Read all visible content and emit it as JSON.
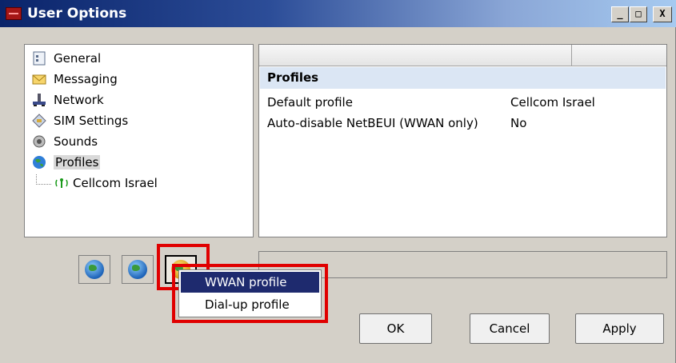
{
  "window": {
    "title": "User Options",
    "controls": {
      "minimize": "_",
      "maximize": "□",
      "close": "X"
    }
  },
  "tree": {
    "items": [
      {
        "label": "General",
        "icon": "general-icon"
      },
      {
        "label": "Messaging",
        "icon": "envelope-icon"
      },
      {
        "label": "Network",
        "icon": "network-icon"
      },
      {
        "label": "SIM Settings",
        "icon": "sim-card-icon"
      },
      {
        "label": "Sounds",
        "icon": "speaker-icon"
      },
      {
        "label": "Profiles",
        "icon": "globe-icon",
        "selected": true
      },
      {
        "label": "Cellcom Israel",
        "icon": "antenna-icon"
      }
    ]
  },
  "properties": {
    "section": "Profiles",
    "rows": [
      {
        "name": "Default profile",
        "value": "Cellcom Israel"
      },
      {
        "name": "Auto-disable NetBEUI (WWAN only)",
        "value": "No"
      }
    ]
  },
  "toolbar": {
    "buttons": [
      {
        "icon": "add-profile-icon"
      },
      {
        "icon": "edit-profile-icon"
      },
      {
        "icon": "new-profile-icon"
      }
    ]
  },
  "context_menu": {
    "items": [
      {
        "label": "WWAN profile",
        "highlighted": true
      },
      {
        "label": "Dial-up profile",
        "highlighted": false
      }
    ]
  },
  "buttons": {
    "ok": "OK",
    "cancel": "Cancel",
    "apply": "Apply"
  },
  "colors": {
    "highlight": "#e00000",
    "selection": "#1e2a6e",
    "section_bg": "#dbe6f4"
  }
}
